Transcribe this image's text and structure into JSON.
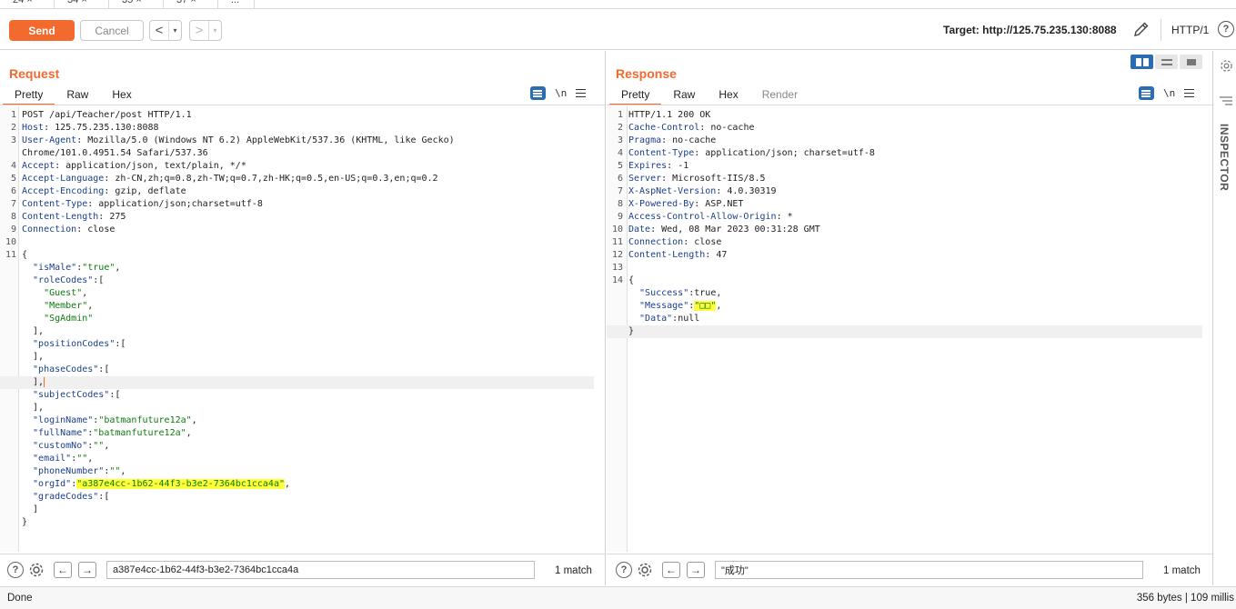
{
  "tabs": [
    {
      "label": "24",
      "close": "×"
    },
    {
      "label": "34",
      "close": "×"
    },
    {
      "label": "35",
      "close": "×"
    },
    {
      "label": "37",
      "close": "×"
    },
    {
      "label": "..."
    }
  ],
  "toolbar": {
    "send_label": "Send",
    "cancel_label": "Cancel",
    "back_arrow": "<",
    "forward_arrow": ">",
    "dropdown_glyph": "▾",
    "target": "Target: http://125.75.235.130:8088",
    "http_version": "HTTP/1",
    "help_glyph": "?"
  },
  "request": {
    "title": "Request",
    "tabs": [
      "Pretty",
      "Raw",
      "Hex"
    ],
    "newline_toggle": "\\n",
    "lines": [
      {
        "no": "1",
        "parts": [
          {
            "t": "POST /api/Teacher/post HTTP/1.1"
          }
        ]
      },
      {
        "no": "2",
        "parts": [
          {
            "t": "Host",
            "c": "hk"
          },
          {
            "t": ": 125.75.235.130:8088"
          }
        ]
      },
      {
        "no": "3",
        "parts": [
          {
            "t": "User-Agent",
            "c": "hk"
          },
          {
            "t": ": Mozilla/5.0 (Windows NT 6.2) AppleWebKit/537.36 (KHTML, like Gecko)"
          }
        ]
      },
      {
        "no": "",
        "parts": [
          {
            "t": "Chrome/101.0.4951.54 Safari/537.36"
          }
        ]
      },
      {
        "no": "4",
        "parts": [
          {
            "t": "Accept",
            "c": "hk"
          },
          {
            "t": ": application/json, text/plain, */*"
          }
        ]
      },
      {
        "no": "5",
        "parts": [
          {
            "t": "Accept-Language",
            "c": "hk"
          },
          {
            "t": ": zh-CN,zh;q=0.8,zh-TW;q=0.7,zh-HK;q=0.5,en-US;q=0.3,en;q=0.2"
          }
        ]
      },
      {
        "no": "6",
        "parts": [
          {
            "t": "Accept-Encoding",
            "c": "hk"
          },
          {
            "t": ": gzip, deflate"
          }
        ]
      },
      {
        "no": "7",
        "parts": [
          {
            "t": "Content-Type",
            "c": "hk"
          },
          {
            "t": ": application/json;charset=utf-8"
          }
        ]
      },
      {
        "no": "8",
        "parts": [
          {
            "t": "Content-Length",
            "c": "hk"
          },
          {
            "t": ": 275"
          }
        ]
      },
      {
        "no": "9",
        "parts": [
          {
            "t": "Connection",
            "c": "hk"
          },
          {
            "t": ": close"
          }
        ]
      },
      {
        "no": "10",
        "parts": []
      },
      {
        "no": "11",
        "parts": [
          {
            "t": "{"
          }
        ]
      },
      {
        "no": "",
        "parts": [
          {
            "t": "  \"isMale\"",
            "c": "hk"
          },
          {
            "t": ":"
          },
          {
            "t": "\"true\"",
            "c": "sv"
          },
          {
            "t": ","
          }
        ]
      },
      {
        "no": "",
        "parts": [
          {
            "t": "  \"roleCodes\"",
            "c": "hk"
          },
          {
            "t": ":["
          }
        ]
      },
      {
        "no": "",
        "parts": [
          {
            "t": "    \"Guest\"",
            "c": "sv"
          },
          {
            "t": ","
          }
        ]
      },
      {
        "no": "",
        "parts": [
          {
            "t": "    \"Member\"",
            "c": "sv"
          },
          {
            "t": ","
          }
        ]
      },
      {
        "no": "",
        "parts": [
          {
            "t": "    \"SgAdmin\"",
            "c": "sv"
          }
        ]
      },
      {
        "no": "",
        "parts": [
          {
            "t": "  ],"
          }
        ]
      },
      {
        "no": "",
        "parts": [
          {
            "t": "  \"positionCodes\"",
            "c": "hk"
          },
          {
            "t": ":["
          }
        ]
      },
      {
        "no": "",
        "parts": [
          {
            "t": "  ],"
          }
        ]
      },
      {
        "no": "",
        "parts": [
          {
            "t": "  \"phaseCodes\"",
            "c": "hk"
          },
          {
            "t": ":["
          }
        ]
      },
      {
        "no": "",
        "cur": true,
        "caret": true,
        "parts": [
          {
            "t": "  ],"
          }
        ]
      },
      {
        "no": "",
        "parts": [
          {
            "t": "  \"subjectCodes\"",
            "c": "hk"
          },
          {
            "t": ":["
          }
        ]
      },
      {
        "no": "",
        "parts": [
          {
            "t": "  ],"
          }
        ]
      },
      {
        "no": "",
        "parts": [
          {
            "t": "  \"loginName\"",
            "c": "hk"
          },
          {
            "t": ":"
          },
          {
            "t": "\"batmanfuture12a\"",
            "c": "sv"
          },
          {
            "t": ","
          }
        ]
      },
      {
        "no": "",
        "parts": [
          {
            "t": "  \"fullName\"",
            "c": "hk"
          },
          {
            "t": ":"
          },
          {
            "t": "\"batmanfuture12a\"",
            "c": "sv"
          },
          {
            "t": ","
          }
        ]
      },
      {
        "no": "",
        "parts": [
          {
            "t": "  \"customNo\"",
            "c": "hk"
          },
          {
            "t": ":"
          },
          {
            "t": "\"\"",
            "c": "sv"
          },
          {
            "t": ","
          }
        ]
      },
      {
        "no": "",
        "parts": [
          {
            "t": "  \"email\"",
            "c": "hk"
          },
          {
            "t": ":"
          },
          {
            "t": "\"\"",
            "c": "sv"
          },
          {
            "t": ","
          }
        ]
      },
      {
        "no": "",
        "parts": [
          {
            "t": "  \"phoneNumber\"",
            "c": "hk"
          },
          {
            "t": ":"
          },
          {
            "t": "\"\"",
            "c": "sv"
          },
          {
            "t": ","
          }
        ]
      },
      {
        "no": "",
        "parts": [
          {
            "t": "  \"orgId\"",
            "c": "hk"
          },
          {
            "t": ":"
          },
          {
            "t": "\"a387e4cc-1b62-44f3-b3e2-7364bc1cca4a\"",
            "c": "sv hl"
          },
          {
            "t": ","
          }
        ]
      },
      {
        "no": "",
        "parts": [
          {
            "t": "  \"gradeCodes\"",
            "c": "hk"
          },
          {
            "t": ":["
          }
        ]
      },
      {
        "no": "",
        "parts": [
          {
            "t": "  ]"
          }
        ]
      },
      {
        "no": "",
        "parts": [
          {
            "t": "}"
          }
        ]
      }
    ],
    "search": {
      "value": "a387e4cc-1b62-44f3-b3e2-7364bc1cca4a",
      "matches": "1 match"
    }
  },
  "response": {
    "title": "Response",
    "tabs": [
      "Pretty",
      "Raw",
      "Hex",
      "Render"
    ],
    "newline_toggle": "\\n",
    "lines": [
      {
        "no": "1",
        "parts": [
          {
            "t": "HTTP/1.1 200 OK"
          }
        ]
      },
      {
        "no": "2",
        "parts": [
          {
            "t": "Cache-Control",
            "c": "hk"
          },
          {
            "t": ": no-cache"
          }
        ]
      },
      {
        "no": "3",
        "parts": [
          {
            "t": "Pragma",
            "c": "hk"
          },
          {
            "t": ": no-cache"
          }
        ]
      },
      {
        "no": "4",
        "parts": [
          {
            "t": "Content-Type",
            "c": "hk"
          },
          {
            "t": ": application/json; charset=utf-8"
          }
        ]
      },
      {
        "no": "5",
        "parts": [
          {
            "t": "Expires",
            "c": "hk"
          },
          {
            "t": ": -1"
          }
        ]
      },
      {
        "no": "6",
        "parts": [
          {
            "t": "Server",
            "c": "hk"
          },
          {
            "t": ": Microsoft-IIS/8.5"
          }
        ]
      },
      {
        "no": "7",
        "parts": [
          {
            "t": "X-AspNet-Version",
            "c": "hk"
          },
          {
            "t": ": 4.0.30319"
          }
        ]
      },
      {
        "no": "8",
        "parts": [
          {
            "t": "X-Powered-By",
            "c": "hk"
          },
          {
            "t": ": ASP.NET"
          }
        ]
      },
      {
        "no": "9",
        "parts": [
          {
            "t": "Access-Control-Allow-Origin",
            "c": "hk"
          },
          {
            "t": ": *"
          }
        ]
      },
      {
        "no": "10",
        "parts": [
          {
            "t": "Date",
            "c": "hk"
          },
          {
            "t": ": Wed, 08 Mar 2023 00:31:28 GMT"
          }
        ]
      },
      {
        "no": "11",
        "parts": [
          {
            "t": "Connection",
            "c": "hk"
          },
          {
            "t": ": close"
          }
        ]
      },
      {
        "no": "12",
        "parts": [
          {
            "t": "Content-Length",
            "c": "hk"
          },
          {
            "t": ": 47"
          }
        ]
      },
      {
        "no": "13",
        "parts": []
      },
      {
        "no": "14",
        "parts": [
          {
            "t": "{"
          }
        ]
      },
      {
        "no": "",
        "parts": [
          {
            "t": "  \"Success\"",
            "c": "hk"
          },
          {
            "t": ":true,"
          }
        ]
      },
      {
        "no": "",
        "parts": [
          {
            "t": "  \"Message\"",
            "c": "hk"
          },
          {
            "t": ":"
          },
          {
            "t": "\"□□\"",
            "c": "sv hl"
          },
          {
            "t": ","
          }
        ]
      },
      {
        "no": "",
        "parts": [
          {
            "t": "  \"Data\"",
            "c": "hk"
          },
          {
            "t": ":null"
          }
        ]
      },
      {
        "no": "",
        "cur": true,
        "parts": [
          {
            "t": "}"
          }
        ]
      }
    ],
    "search": {
      "value": "\"成功\"",
      "matches": "1 match"
    }
  },
  "inspector": {
    "label": "INSPECTOR"
  },
  "status": {
    "left": "Done",
    "right": "356 bytes | 109 millis"
  },
  "colors": {
    "accent": "#f26a2e",
    "blue": "#2b6db5",
    "highlight": "#ffff3a"
  }
}
